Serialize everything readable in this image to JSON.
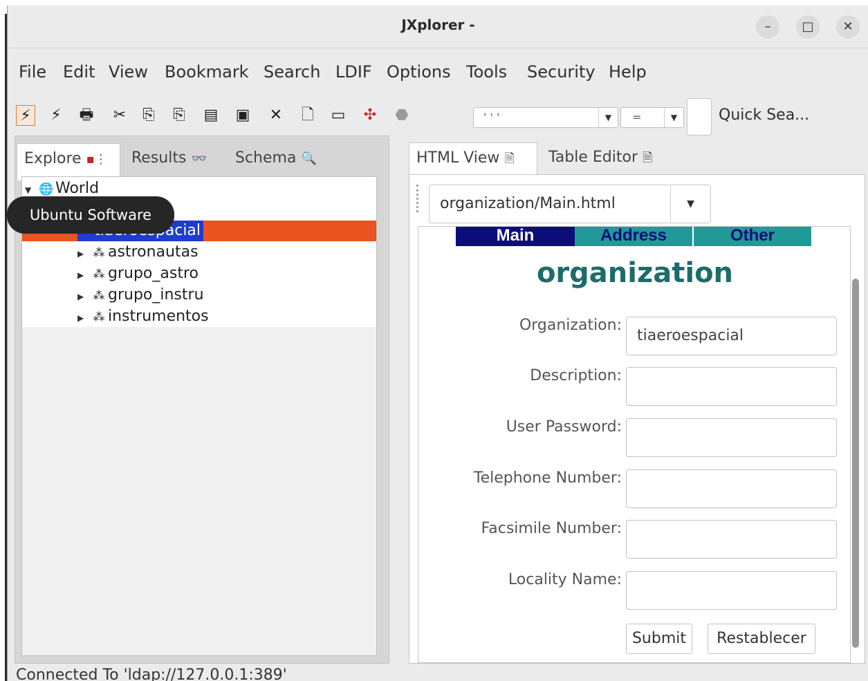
{
  "window": {
    "title": "JXplorer -",
    "minimize_glyph": "–",
    "maximize_glyph": "□",
    "close_glyph": "✕"
  },
  "menu": [
    {
      "label": "File"
    },
    {
      "label": "Edit"
    },
    {
      "label": "View"
    },
    {
      "label": "Bookmark"
    },
    {
      "label": "Search"
    },
    {
      "label": "LDIF"
    },
    {
      "label": "Options"
    },
    {
      "label": "Tools"
    },
    {
      "label": "Security"
    },
    {
      "label": "Help"
    }
  ],
  "toolbar": {
    "icons": [
      "connect-icon",
      "disconnect-icon",
      "print-icon",
      "cut-icon",
      "copy-icon",
      "copy-dn-icon",
      "paste-icon",
      "paste-alias-icon",
      "delete-icon",
      "new-icon",
      "rename-icon",
      "refresh-icon",
      "stop-icon"
    ],
    "search_attr_value": "' ' '",
    "search_op_value": "=",
    "quick_search_label": "Quick Sea..."
  },
  "left_tabs": {
    "explore": "Explore",
    "results": "Results",
    "schema": "Schema"
  },
  "tree": {
    "root": "World",
    "selected": "tiaeroespacial",
    "children": [
      "astronautas",
      "grupo_astro",
      "grupo_instru",
      "instrumentos"
    ]
  },
  "tooltip": "Ubuntu Software",
  "right_tabs": {
    "html_view": "HTML View",
    "table_editor": "Table Editor"
  },
  "template_path": "organization/Main.html",
  "html_form": {
    "nav": [
      "Main",
      "Address",
      "Other"
    ],
    "heading": "organization",
    "fields": [
      {
        "label": "Organization:",
        "value": "tiaeroespacial"
      },
      {
        "label": "Description:",
        "value": ""
      },
      {
        "label": "User Password:",
        "value": ""
      },
      {
        "label": "Telephone Number:",
        "value": ""
      },
      {
        "label": "Facsimile Number:",
        "value": ""
      },
      {
        "label": "Locality Name:",
        "value": ""
      }
    ],
    "submit": "Submit",
    "reset": "Restablecer"
  },
  "status": "Connected To 'ldap://127.0.0.1:389'",
  "colors": {
    "selection_row": "#e95420",
    "selection_label": "#1e3ccd",
    "nav_main": "#0d0d7a",
    "nav_other": "#1f9a97",
    "heading": "#1e6b6b"
  }
}
